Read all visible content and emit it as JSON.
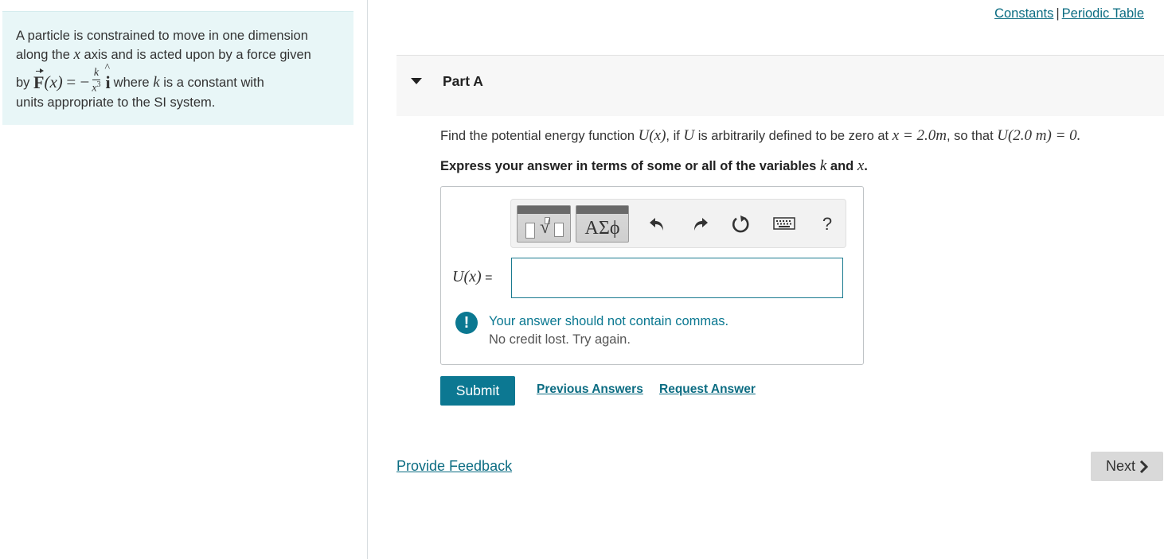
{
  "problem": {
    "line1": "A particle is constrained to move in one dimension",
    "line2_pre": "along the",
    "line2_var": "x",
    "line2_post": "axis and is acted upon by a force given",
    "line3_by": "by",
    "force_symbol": "F",
    "force_arg": "(x)",
    "equals_minus": "= −",
    "frac_num": "k",
    "frac_den": "x",
    "frac_den_exp": "3",
    "unit_vector": "i",
    "line3_where": "where",
    "line3_var": "k",
    "line3_post": "is a constant with",
    "line4": "units appropriate to the SI system."
  },
  "links": {
    "constants": "Constants",
    "separator": "|",
    "periodic_table": "Periodic Table"
  },
  "part": {
    "title": "Part A"
  },
  "question": {
    "pre": "Find the potential energy function",
    "func": "U(x)",
    "mid1": ", if",
    "var_u": "U",
    "mid2": "is arbitrarily defined to be zero at",
    "cond": "x = 2.0m",
    "mid3": ", so that",
    "eq": "U(2.0 m) = 0.",
    "instruction_pre": "Express your answer in terms of some or all of the variables",
    "instr_var1": "k",
    "instruction_and": "and",
    "instr_var2": "x",
    "instruction_end": "."
  },
  "toolbar": {
    "greek_label": "ΑΣϕ",
    "help_label": "?",
    "icons": [
      "templates-icon",
      "greek-symbols-icon",
      "undo-icon",
      "redo-icon",
      "reset-icon",
      "keyboard-icon",
      "help-icon"
    ]
  },
  "answer": {
    "label_func": "U(x)",
    "label_eq": "=",
    "value": "",
    "feedback_icon": "!",
    "feedback_main": "Your answer should not contain commas.",
    "feedback_sub": "No credit lost. Try again."
  },
  "actions": {
    "submit": "Submit",
    "previous_answers": "Previous Answers",
    "request_answer": "Request Answer",
    "provide_feedback": "Provide Feedback",
    "next": "Next"
  },
  "colors": {
    "accent": "#0c7892",
    "link": "#0b6c82",
    "problem_bg": "#e8f6f7",
    "header_bg": "#f7f7f7"
  }
}
